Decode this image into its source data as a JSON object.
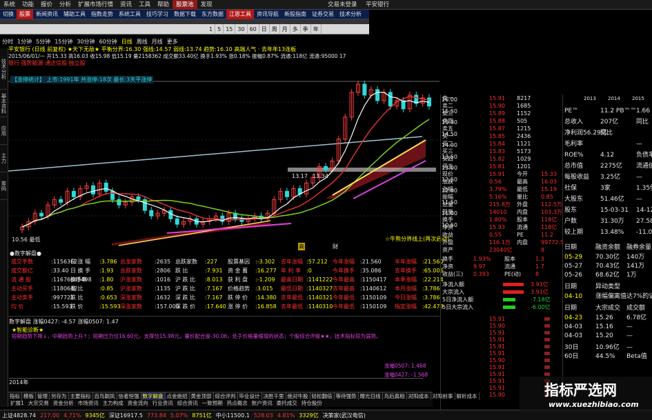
{
  "menu": {
    "items": [
      "系统",
      "功能",
      "报价",
      "分析",
      "扩展市场行情",
      "资讯",
      "工具",
      "帮助",
      "股票池",
      "发现"
    ],
    "selected_index": 8,
    "right_items": [
      "交易未登录",
      "平安银行"
    ]
  },
  "navbar": {
    "items": [
      "切换",
      "股票",
      "新闻资讯",
      "辅助工具",
      "指数走势",
      "系统工具",
      "技巧学习",
      "数据下载",
      "东方数据",
      "江恩工具",
      "资讯导航",
      "新股指南",
      "证券交易",
      "技术分析"
    ],
    "highlighted": [
      1,
      9
    ]
  },
  "periodbar": {
    "items": [
      "1",
      "5",
      "15",
      "30",
      "60",
      "日",
      "周",
      "月",
      "多",
      "季",
      "年"
    ]
  },
  "period_tabs": {
    "items": [
      "分时",
      "1分钟",
      "5分钟",
      "15分钟",
      "30分钟",
      "60分钟",
      "日线",
      "周线",
      "月线",
      "更多"
    ],
    "current_index": 6
  },
  "chart_header": {
    "line1": "平安银行 (日线 前复权) ★天下无敌★ 平衡分界:16.30 强线:14.57 弱线:13.74 趋势:16.10 高端人气 · 去年年13连板",
    "line2": "2015/06/01/一 开15.33 高16.03 收15.98 低15.19 量2158362 成交额33.40亿 换手1.93% 涨0.18% 振幅0.87% 流通:118亿 流通:95000 17",
    "line3": "银行 强势能源 通达信股 独立股"
  },
  "chart_subheader": {
    "text": "【涨停统计】  上市:1991年  共涨停:18次  最长:3天平涨停"
  },
  "vtabs": [
    "技术分析",
    "基本资料",
    "应用",
    "主力",
    "筹码"
  ],
  "chart_labels": {
    "price_right": [
      "16.00",
      "15.50",
      "15.00",
      "14.50",
      "14.00",
      "13.50",
      "13.00",
      "12.50",
      "12.00",
      "11.50",
      "11.00",
      "10.50"
    ],
    "low_label": "10.56 最低",
    "mark1": "13.17",
    "mark2": "13.34",
    "legend": "☆牛熊分界线上(再次启动)",
    "foot_tags": [
      "高",
      "财"
    ]
  },
  "chart_data": {
    "type": "candlestick",
    "ylim": [
      10.4,
      16.3
    ],
    "series": [
      {
        "name": "K",
        "values": [
          11.0,
          11.2,
          11.5,
          11.4,
          11.8,
          12.0,
          11.9,
          12.3,
          12.1,
          12.4,
          12.5,
          12.2,
          12.6,
          12.3,
          12.0,
          11.8,
          11.9,
          12.1,
          12.0,
          11.6,
          11.4,
          11.5,
          11.6,
          11.3,
          11.1,
          11.2,
          11.3,
          11.1,
          11.2,
          11.3,
          11.4,
          11.2,
          11.5,
          11.3,
          11.2,
          11.3,
          11.4,
          11.3,
          11.5,
          12.0,
          12.3,
          12.1,
          12.4,
          12.2,
          12.6,
          12.8,
          13.2,
          13.1,
          13.4,
          14.2,
          15.0,
          15.9,
          16.2,
          15.8,
          16.0,
          15.6,
          15.9,
          15.4,
          15.6,
          15.3,
          15.8,
          15.5,
          15.7,
          15.4
        ]
      }
    ]
  },
  "stats": {
    "title": "●数字解盘●",
    "rows": [
      [
        "成交手数",
        ":1156362",
        "日 涨 幅",
        ":3.786",
        "总涨家数",
        ":2635",
        "总跌家数",
        ":227",
        "股票基因",
        ":-3.302",
        "去年涨幅",
        ":57.212",
        "今年涨幅",
        ":21.560",
        "半年涨幅",
        ":21.560"
      ],
      [
        "成交额亿",
        ":33.40",
        "日 换 手",
        ":1.93",
        "总跌家数",
        ":2806",
        "跌 比",
        ":7.931",
        "资 金 蓄",
        ":16.277",
        "年 利 率",
        ":0",
        "今年换手",
        ":35.086",
        "去年换手",
        ":65.006"
      ],
      [
        "流 通 股",
        ":11676645498",
        "换手率",
        ":1.80",
        "沪涨家数",
        ":1016",
        "沪 跌 比",
        ":8.013",
        "获 利 盘",
        ":-1.209",
        "最高日期",
        ":1141222",
        "今年最高",
        ":1150417",
        "本季涨幅",
        ":22.214"
      ],
      [
        "主动买手",
        ":1180642",
        "量 比",
        ":0.85",
        "沪涨家数",
        ":1135",
        "沪 跌 比",
        ":7.167",
        "价格趋势",
        ":3.015",
        "最低日期",
        ":1140327",
        "去年最高",
        ":1140612",
        "本月涨幅",
        ":3.786"
      ],
      [
        "主动卖手",
        ":997721",
        "跌 比",
        ":0.653",
        "深涨家数",
        ":1632",
        "深 跌 比",
        ":7.167",
        "跌 停 价",
        ":14.380",
        "去年最低",
        ":1140321",
        "今年最低",
        ":1150109",
        "今日涨幅",
        ":3.786"
      ],
      [
        "均 价",
        ":15.593",
        "跌 价",
        ":15.593",
        "深涨家数",
        ":157.000",
        "深 跌 价",
        ":17.640",
        "涨 停 价",
        ":16.858",
        "去年最低",
        ":1140310",
        "今年最低",
        ":1150109",
        "指定涨幅",
        ":42.473"
      ]
    ]
  },
  "comment": {
    "line1": "数字解盘  涨幅0427: -4.57  涨幅0507: 1.47",
    "title": "★智能诊断★",
    "body": "短期趋势下降↓，中期趋势上升↑；短期压力位16.60元，支撑位15.98元，量价配合度-30.06，处于价格量缩增的状态；个股综合评级★★，技术指标较为弱势。",
    "foot1": "涨幅0507:  1.468",
    "foot2": "涨幅0427: -1.568",
    "year": "2014年"
  },
  "quote": {
    "rows": [
      [
        "卖一",
        "15.91",
        "8217"
      ],
      [
        "卖二",
        "15.90",
        "1685"
      ],
      [
        "卖三",
        "15.89",
        "1152"
      ],
      [
        "卖四",
        "15.88",
        "505"
      ],
      [
        "卖五",
        "15.87",
        "1215"
      ],
      [
        "买一",
        "15.85",
        "2436"
      ],
      [
        "买二",
        "15.84",
        "1121"
      ],
      [
        "买三",
        "15.83",
        "5173"
      ],
      [
        "买四",
        "15.82",
        "1029"
      ],
      [
        "买五",
        "15.81",
        "1201"
      ],
      [
        "现价",
        "15.91",
        "今开",
        "15.33"
      ],
      [
        "涨跌",
        "0.56",
        "最高",
        "16.03"
      ],
      [
        "涨幅",
        "3.79%",
        "最低",
        "15.19"
      ],
      [
        "振幅",
        "5.16%",
        "量比",
        "0.85"
      ],
      [
        "总量",
        "215.8万",
        "外盘",
        "112.5万"
      ],
      [
        "现量",
        "14010",
        "内盘",
        "103.3万"
      ],
      [
        "换手",
        "1.80%",
        "股本",
        "118亿"
      ],
      [
        "净资",
        "15.93",
        "流通",
        "118亿"
      ],
      [
        "收益",
        "0.55",
        "PE",
        "11.2"
      ],
      [
        "外盘",
        "116.1万",
        "内盘",
        "99772.5"
      ],
      [
        "资产",
        "23040亿",
        "",
        "8"
      ]
    ],
    "funds_title": "资金流向",
    "funds": [
      [
        "换手",
        "1.93%",
        "股本",
        "1.3"
      ],
      [
        "净资",
        "9.97",
        "流通",
        "1.7"
      ],
      [
        "收益(三)",
        "0.393",
        "PE(动)",
        "8"
      ]
    ],
    "flows": [
      [
        "净流入额",
        "",
        "3.91亿"
      ],
      [
        "大宗流入",
        "",
        "3.91亿"
      ],
      [
        "5日净流入额",
        "",
        "-7.18亿"
      ],
      [
        "5日大宗流入",
        "",
        "-6.00亿"
      ]
    ],
    "ticks": [
      "15.91",
      "15.90",
      "15.91",
      "15.91",
      "15.91",
      "15.91",
      "15.90",
      "15.91",
      "15.91",
      "15.91",
      "15.91",
      "15.90"
    ]
  },
  "fund": {
    "years": [
      "2013",
      "2014",
      "2015"
    ],
    "rows": [
      [
        "PE™",
        "11.2 PB™™",
        "1.66"
      ],
      [
        "总收入",
        "207亿",
        "同比"
      ],
      [
        "净利润56.29亿",
        "同比"
      ],
      [
        "毛利率",
        "",
        "—"
      ],
      [
        "ROE%",
        "4.12",
        "负债率"
      ],
      [
        "总市值",
        "2275亿",
        "流通值"
      ],
      [
        "每股收益",
        "3.25亿",
        "—"
      ],
      [
        "社保",
        "3家",
        "1.35亿"
      ],
      [
        "大股东",
        "51.46亿",
        "—"
      ],
      [
        "股东",
        "15-03-31",
        "14-12-31"
      ],
      [
        "户数",
        "31.30万",
        "27.58万"
      ],
      [
        "较上期",
        "13.48%",
        "-11.04%"
      ]
    ],
    "margin_head": [
      "日期",
      "融资余额",
      "融券余量"
    ],
    "margin": [
      [
        "05-29",
        "70.30亿",
        "140万"
      ],
      [
        "05-27",
        "70.43亿",
        "141万"
      ],
      [
        "05-26",
        "68.62亿",
        "1万"
      ]
    ],
    "abn_head": [
      "日期",
      "异动类型"
    ],
    "abn": [
      [
        "04-10",
        "涨幅偏离值达7%的证券"
      ]
    ],
    "block_head": [
      "日期",
      "大宗成交",
      "成交额"
    ],
    "block": [
      [
        "04-23",
        "15.26",
        "6.78亿"
      ],
      [
        "04-03",
        "15.16",
        "—"
      ],
      [
        "04-03",
        "15.20",
        "—"
      ]
    ],
    "extra": [
      [
        "30日",
        "10.96亿",
        "—"
      ],
      [
        "60日",
        "44.5%",
        "Beta值"
      ]
    ]
  },
  "bottom_tabs": {
    "items": [
      "指标",
      "模板",
      "管理",
      "另存为",
      "主要指标",
      "百鸟朝凤",
      "信者恒强",
      "数字解盘",
      "点金绝招",
      "黄金顶部",
      "综合评判",
      "毕业设计",
      "决胜千里",
      "绝对牛股",
      "轻松翻倍",
      "等待强势",
      "曝光日线",
      "鸟后真相",
      "对阳成本",
      "对阳前事",
      "解析成本"
    ],
    "current_index": 7
  },
  "func_tabs": {
    "items": [
      "扩展1",
      "大宗交易",
      "资金分析",
      "市场资讯",
      "主力构成",
      "资金流向",
      "行业资讯",
      "综合资讯",
      "一致预期",
      "热点概念",
      "账户资讯",
      "委托成交",
      "持仓股份"
    ]
  },
  "status": {
    "items": [
      "上证4828.74",
      "217.00",
      "4.71%",
      "9345亿",
      "深证16917.5",
      "773.84",
      "5.07%",
      "8751亿",
      "中小11500.1",
      "528.03",
      "4.81%",
      "3329亿",
      "决策家(武汉电信)"
    ]
  },
  "watermark": {
    "title": "指标严选网",
    "url": "www.xuezhibiao.com"
  }
}
